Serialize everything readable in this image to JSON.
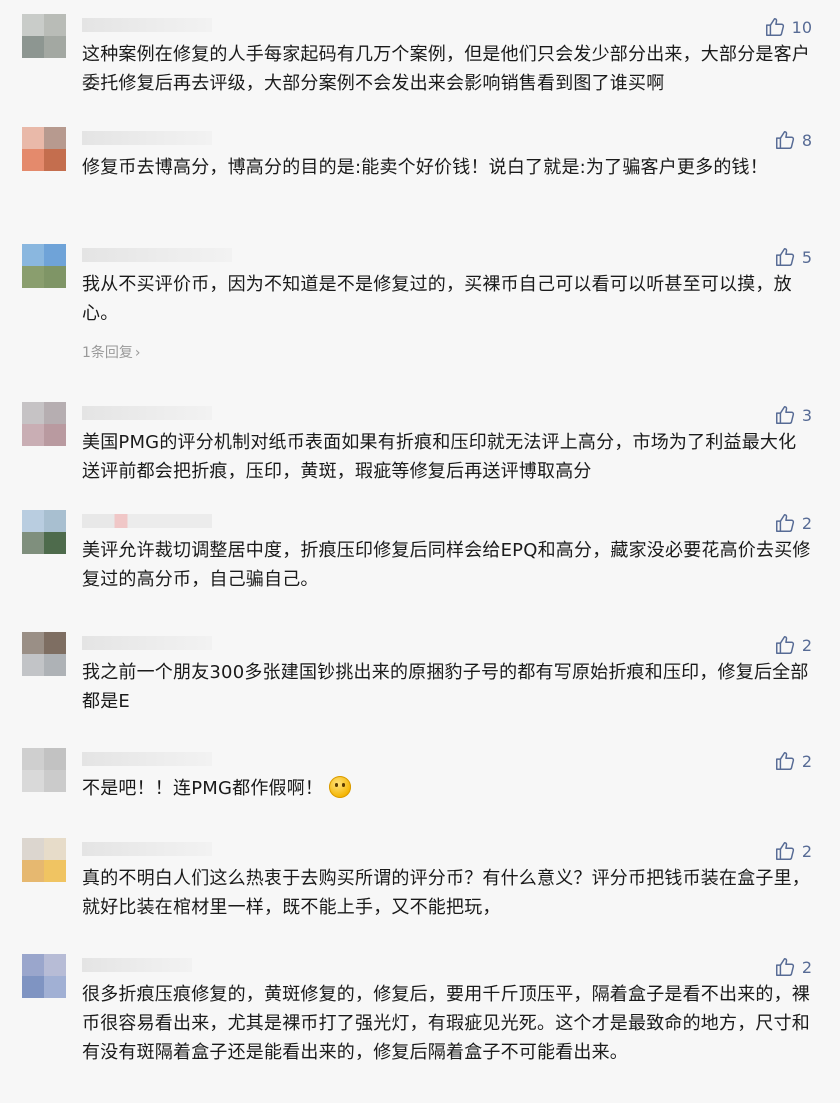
{
  "comments": [
    {
      "likes": "10",
      "text": "这种案例在修复的人手每家起码有几万个案例，但是他们只会发少部分出来，大部分是客户委托修复后再去评级，大部分案例不会发出来会影响销售看到图了谁买啊",
      "avatar_colors": [
        "#c9ccc9",
        "#b9bcb7",
        "#8d9691",
        "#a3a8a2"
      ]
    },
    {
      "likes": "8",
      "text": "修复币去博高分，博高分的目的是:能卖个好价钱！说白了就是:为了骗客户更多的钱！",
      "avatar_colors": [
        "#e9b9a9",
        "#b79a8f",
        "#e48a6c",
        "#c46e4e"
      ]
    },
    {
      "likes": "5",
      "text": "我从不买评价币，因为不知道是不是修复过的，买裸币自己可以看可以听甚至可以摸，放心。",
      "reply_label": "1条回复",
      "avatar_colors": [
        "#8ab7df",
        "#6fa3d8",
        "#8a9e6e",
        "#7f9566"
      ]
    },
    {
      "likes": "3",
      "text": "美国PMG的评分机制对纸币表面如果有折痕和压印就无法评上高分，市场为了利益最大化送评前都会把折痕，压印，黄斑，瑕疵等修复后再送评博取高分",
      "avatar_colors": [
        "#c6c3c5",
        "#b6aeb1",
        "#c9aeb4",
        "#b99aa0"
      ]
    },
    {
      "likes": "2",
      "text": "美评允许裁切调整居中度，折痕压印修复后同样会给EPQ和高分，藏家没必要花高价去买修复过的高分币，自己骗自己。",
      "avatar_colors": [
        "#b9cde0",
        "#a8bfd0",
        "#7f8f7d",
        "#4e6b4c"
      ]
    },
    {
      "likes": "2",
      "text": "我之前一个朋友300多张建国钞挑出来的原捆豹子号的都有写原始折痕和压印，修复后全部都是E",
      "avatar_colors": [
        "#9a8f86",
        "#7e6e62",
        "#c2c4c7",
        "#aeb2b6"
      ]
    },
    {
      "likes": "2",
      "text": "不是吧！！连PMG都作假啊！",
      "avatar_colors": [
        "#cfcfcf",
        "#c2c2c2",
        "#d9d9d9",
        "#cbcbcb"
      ]
    },
    {
      "likes": "2",
      "text": "真的不明白人们这么热衷于去购买所谓的评分币？有什么意义？评分币把钱币装在盒子里，就好比装在棺材里一样，既不能上手，又不能把玩，",
      "avatar_colors": [
        "#dcd6cf",
        "#e7dcc9",
        "#e6b870",
        "#f0c462"
      ]
    },
    {
      "likes": "2",
      "text": "很多折痕压痕修复的，黄斑修复的，修复后，要用千斤顶压平，隔着盒子是看不出来的，裸币很容易看出来，尤其是裸币打了强光灯，有瑕疵见光死。这个才是最致命的地方，尺寸和有没有斑隔着盒子还是能看出来的，修复后隔着盒子不可能看出来。",
      "avatar_colors": [
        "#9aa6cc",
        "#b7bcd6",
        "#7f94c2",
        "#a1b0d4"
      ]
    }
  ]
}
